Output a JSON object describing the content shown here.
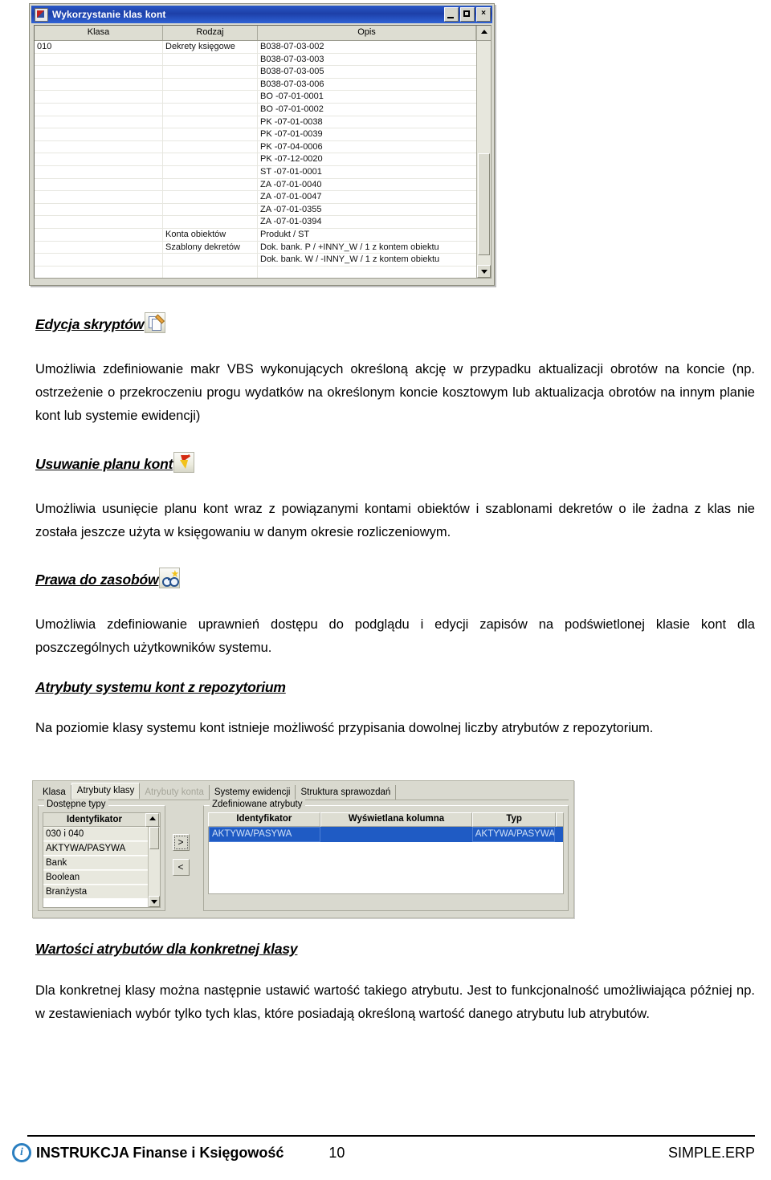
{
  "window1": {
    "title": "Wykorzystanie klas kont",
    "icon": "app-icon",
    "buttons": {
      "minimize": "–",
      "maximize": "□",
      "close": "×"
    },
    "columns": [
      "Klasa",
      "Rodzaj",
      "Opis"
    ],
    "rows": [
      {
        "klasa": "010",
        "rodzaj": "Dekrety księgowe",
        "opis": "B038-07-03-002"
      },
      {
        "klasa": "",
        "rodzaj": "",
        "opis": "B038-07-03-003"
      },
      {
        "klasa": "",
        "rodzaj": "",
        "opis": "B038-07-03-005"
      },
      {
        "klasa": "",
        "rodzaj": "",
        "opis": "B038-07-03-006"
      },
      {
        "klasa": "",
        "rodzaj": "",
        "opis": "BO  -07-01-0001"
      },
      {
        "klasa": "",
        "rodzaj": "",
        "opis": "BO  -07-01-0002"
      },
      {
        "klasa": "",
        "rodzaj": "",
        "opis": "PK  -07-01-0038"
      },
      {
        "klasa": "",
        "rodzaj": "",
        "opis": "PK  -07-01-0039"
      },
      {
        "klasa": "",
        "rodzaj": "",
        "opis": "PK  -07-04-0006"
      },
      {
        "klasa": "",
        "rodzaj": "",
        "opis": "PK  -07-12-0020"
      },
      {
        "klasa": "",
        "rodzaj": "",
        "opis": "ST  -07-01-0001"
      },
      {
        "klasa": "",
        "rodzaj": "",
        "opis": "ZA  -07-01-0040"
      },
      {
        "klasa": "",
        "rodzaj": "",
        "opis": "ZA  -07-01-0047"
      },
      {
        "klasa": "",
        "rodzaj": "",
        "opis": "ZA  -07-01-0355"
      },
      {
        "klasa": "",
        "rodzaj": "",
        "opis": "ZA  -07-01-0394"
      },
      {
        "klasa": "",
        "rodzaj": "Konta obiektów",
        "opis": "Produkt / ST"
      },
      {
        "klasa": "",
        "rodzaj": "Szablony dekretów",
        "opis": "Dok. bank. P / +INNY_W / 1 z kontem obiektu"
      },
      {
        "klasa": "",
        "rodzaj": "",
        "opis": "Dok. bank. W / -INNY_W / 1 z kontem obiektu"
      },
      {
        "klasa": "",
        "rodzaj": "",
        "opis": ""
      }
    ]
  },
  "sections": {
    "scripts": {
      "heading": "Edycja skryptów",
      "icon": "script-edit-icon",
      "paragraph": "Umożliwia zdefiniowanie makr VBS wykonujących określoną akcję w przypadku aktualizacji obrotów na koncie (np. ostrzeżenie o przekroczeniu progu wydatków na określonym koncie kosztowym lub aktualizacja obrotów na innym planie kont lub systemie ewidencji)"
    },
    "delete_plan": {
      "heading": "Usuwanie planu kont",
      "icon": "lightning-bolt-icon",
      "paragraph": "Umożliwia usunięcie planu kont wraz z powiązanymi kontami obiektów i szablonami dekretów o ile żadna z klas nie została jeszcze użyta w księgowaniu w danym okresie rozliczeniowym."
    },
    "rights": {
      "heading": "Prawa do zasobów",
      "icon": "glasses-star-icon",
      "paragraph": "Umożliwia zdefiniowanie uprawnień dostępu do podglądu i edycji zapisów na podświetlonej klasie kont dla poszczególnych użytkowników systemu."
    },
    "attributes": {
      "heading": "Atrybuty systemu kont z repozytorium",
      "paragraph": "Na poziomie klasy systemu kont istnieje możliwość przypisania dowolnej liczby atrybutów z repozytorium."
    },
    "values": {
      "heading": "Wartości atrybutów dla konkretnej klasy",
      "paragraph": "Dla konkretnej klasy można następnie ustawić wartość takiego atrybutu. Jest to funkcjonalność umożliwiająca później np. w zestawieniach wybór tylko tych klas, które posiadają określoną wartość danego atrybutu lub atrybutów."
    }
  },
  "window2": {
    "tabs": [
      {
        "label": "Klasa",
        "state": "normal"
      },
      {
        "label": "Atrybuty klasy",
        "state": "active"
      },
      {
        "label": "Atrybuty konta",
        "state": "disabled"
      },
      {
        "label": "Systemy ewidencji",
        "state": "normal"
      },
      {
        "label": "Struktura sprawozdań",
        "state": "normal"
      }
    ],
    "left_group": {
      "legend": "Dostępne typy",
      "column_header": "Identyfikator",
      "items": [
        "030 i 040",
        "AKTYWA/PASYWA",
        "Bank",
        "Boolean",
        "Branżysta"
      ]
    },
    "move_buttons": {
      "add": ">",
      "remove": "<"
    },
    "right_group": {
      "legend": "Zdefiniowane atrybuty",
      "columns": [
        "Identyfikator",
        "Wyświetlana kolumna",
        "Typ"
      ],
      "rows": [
        {
          "identyfikator": "AKTYWA/PASYWA",
          "kolumna": "",
          "typ": "AKTYWA/PASYWA"
        }
      ]
    }
  },
  "footer": {
    "icon": "info-circle-icon",
    "title": "INSTRUKCJA Finanse i Księgowość",
    "page": "10",
    "brand": "SIMPLE.ERP"
  },
  "colors": {
    "titlebar": "#1d3fa8",
    "selection": "#1f5bc4",
    "panel": "#d9d9cf",
    "accent": "#2b7fc0"
  }
}
